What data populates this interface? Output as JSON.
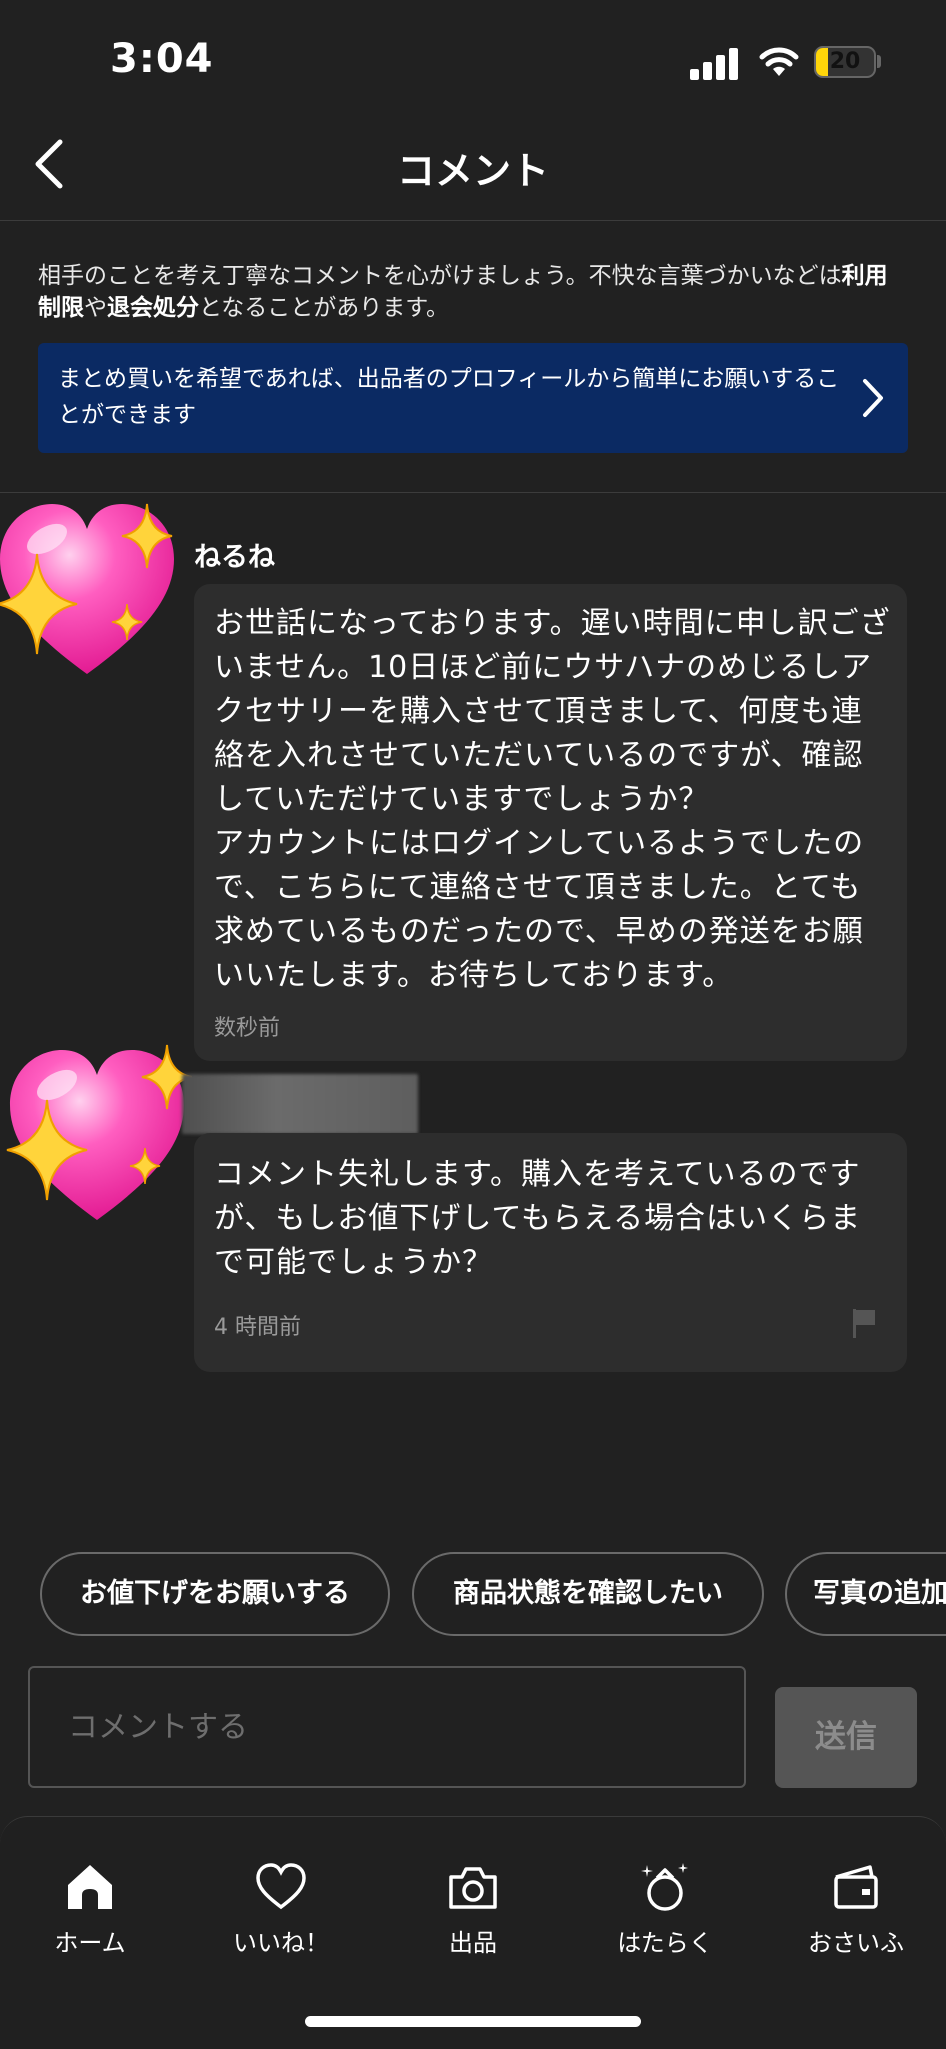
{
  "status_bar": {
    "time": "3:04",
    "battery": "20",
    "battery_level": 0.2
  },
  "header": {
    "title": "コメント"
  },
  "notice": {
    "part1": "相手のことを考え丁寧なコメントを心がけましょう。不快な言葉づかいなどは",
    "bold1": "利用制限",
    "part2": "や",
    "bold2": "退会処分",
    "part3": "となることがあります。"
  },
  "banner": {
    "text": "まとめ買いを希望であれば、出品者のプロフィールから簡単にお願いすることができます"
  },
  "comments": [
    {
      "name": "ねるね",
      "text": "お世話になっております。遅い時間に申し訳ございません。10日ほど前にウサハナのめじるしアクセサリーを購入させて頂きまして、何度も連絡を入れさせていただいているのですが、確認していただけていますでしょうか？\nアカウントにはログインしているようでしたので、こちらにて連絡させて頂きました。とても求めているものだったので、早めの発送をお願いいたします。お待ちしております。",
      "time": "数秒前"
    },
    {
      "name": "",
      "text": "コメント失礼します。購入を考えているのですが、もしお値下げしてもらえる場合はいくらまで可能でしょうか？",
      "time": "4 時間前"
    }
  ],
  "quick_replies": [
    "お値下げをお願いする",
    "商品状態を確認したい",
    "写真の追加"
  ],
  "input": {
    "placeholder": "コメントする",
    "send_label": "送信"
  },
  "nav": [
    {
      "label": "ホーム",
      "icon": "home-icon"
    },
    {
      "label": "いいね！",
      "icon": "heart-icon"
    },
    {
      "label": "出品",
      "icon": "camera-icon"
    },
    {
      "label": "はたらく",
      "icon": "sparkle-bag-icon"
    },
    {
      "label": "おさいふ",
      "icon": "wallet-icon"
    }
  ],
  "colors": {
    "background": "#212121",
    "banner": "#0b2a63",
    "bubble": "#2d2d2d",
    "heart": "#ff4fb4",
    "sparkle": "#ffd43b"
  }
}
